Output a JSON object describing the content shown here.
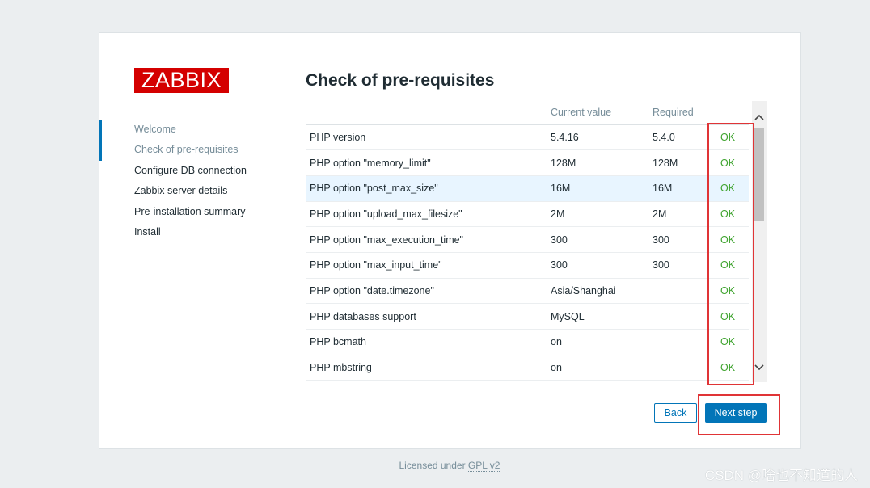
{
  "logo": "ZABBIX",
  "nav": [
    "Welcome",
    "Check of pre-requisites",
    "Configure DB connection",
    "Zabbix server details",
    "Pre-installation summary",
    "Install"
  ],
  "title": "Check of pre-requisites",
  "table": {
    "headers": [
      "",
      "Current value",
      "Required",
      ""
    ],
    "rows": [
      [
        "PHP version",
        "5.4.16",
        "5.4.0",
        "OK"
      ],
      [
        "PHP option \"memory_limit\"",
        "128M",
        "128M",
        "OK"
      ],
      [
        "PHP option \"post_max_size\"",
        "16M",
        "16M",
        "OK"
      ],
      [
        "PHP option \"upload_max_filesize\"",
        "2M",
        "2M",
        "OK"
      ],
      [
        "PHP option \"max_execution_time\"",
        "300",
        "300",
        "OK"
      ],
      [
        "PHP option \"max_input_time\"",
        "300",
        "300",
        "OK"
      ],
      [
        "PHP option \"date.timezone\"",
        "Asia/Shanghai",
        "",
        "OK"
      ],
      [
        "PHP databases support",
        "MySQL",
        "",
        "OK"
      ],
      [
        "PHP bcmath",
        "on",
        "",
        "OK"
      ],
      [
        "PHP mbstring",
        "on",
        "",
        "OK"
      ]
    ]
  },
  "buttons": {
    "back": "Back",
    "next": "Next step"
  },
  "footer": {
    "prefix": "Licensed under ",
    "link": "GPL v2"
  },
  "watermark": "CSDN @啥也不知道的人",
  "colors": {
    "accent": "#0275b8",
    "ok": "#3ea32e",
    "logo_bg": "#d40000",
    "annotation": "#e03436"
  }
}
